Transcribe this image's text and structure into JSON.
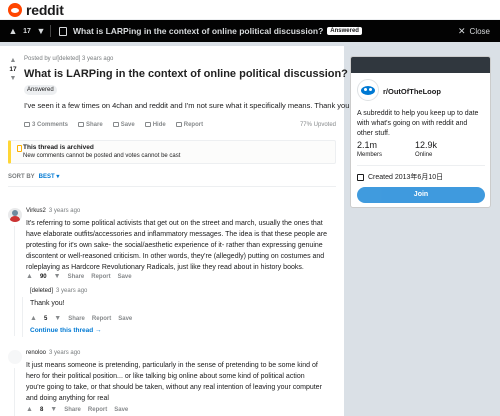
{
  "header": {
    "logo_text": "reddit"
  },
  "postbar": {
    "score": "17",
    "title": "What is LARPing in the context of online political discussion?",
    "badge": "Answered",
    "close_label": "Close"
  },
  "post": {
    "score": "17",
    "meta": "Posted by u/[deleted] 3 years ago",
    "title": "What is LARPing in the context of online political discussion?",
    "flair": "Answered",
    "body": "I've seen it a few times on 4chan and reddit and I'm not sure what it specifically means. Thank you!",
    "actions": [
      "3 Comments",
      "Share",
      "Save",
      "Hide",
      "Report"
    ],
    "upvoted": "77% Upvoted"
  },
  "archive": {
    "title": "This thread is archived",
    "subtitle": "New comments cannot be posted and votes cannot be cast"
  },
  "sort": {
    "label": "SORT BY",
    "value": "BEST"
  },
  "comments": [
    {
      "author": "Virkus2",
      "time": "3 years ago",
      "lines": [
        "It's referring to some political activists that get out on the street and march, usually the ones that",
        "have elaborate outfits/accessories and inflammatory messages. The idea is that these people are",
        "protesting for it's own sake- the social/aesthetic experience of it- rather than expressing genuine",
        "discontent or well-reasoned criticism. In other words, they're (allegedly) putting on costumes and",
        "roleplaying as Hardcore Revolutionary Radicals, just like they read about in history books."
      ],
      "score": "90",
      "actions": [
        "Share",
        "Report",
        "Save"
      ]
    },
    {
      "author": "[deleted]",
      "time": "3 years ago",
      "lines": [
        "Thank you!"
      ],
      "score": "5",
      "actions": [
        "Share",
        "Report",
        "Save"
      ],
      "continue": "Continue this thread →"
    },
    {
      "author": "renoloo",
      "time": "3 years ago",
      "lines": [
        "It just means someone is pretending, particularly in the sense of pretending to be some kind of",
        "hero for their political position... or like talking big online about some kind of political action",
        "you're going to take, or that should be taken, without any real intention of leaving your computer",
        "and doing anything for real"
      ],
      "score": "8",
      "actions": [
        "Share",
        "Report",
        "Save"
      ]
    }
  ],
  "sidebar": {
    "name": "r/OutOfTheLoop",
    "description": "A subreddit to help you keep up to date with what's going on with reddit and other stuff.",
    "members_value": "2.1m",
    "members_label": "Members",
    "online_value": "12.9k",
    "online_label": "Online",
    "created": "Created 2013年6月10日",
    "join_label": "Join"
  },
  "icons": [
    "reddit-logo-icon",
    "upvote-icon",
    "downvote-icon",
    "post-icon",
    "close-icon",
    "comment-icon",
    "share-icon",
    "save-icon",
    "hide-icon",
    "report-icon",
    "lock-icon",
    "avatar-icon",
    "cake-icon",
    "subreddit-icon"
  ],
  "colors": {
    "accent": "#0079d3",
    "brand": "#ff4500",
    "archive_border": "#ffd635",
    "topbar_dark": "#030303"
  }
}
